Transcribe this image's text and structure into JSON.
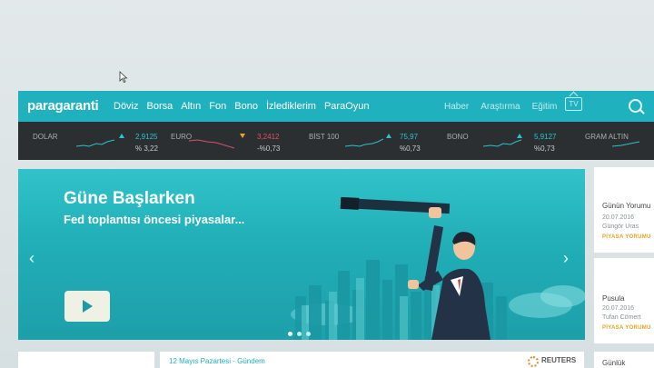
{
  "brand": {
    "logo": "paragaranti"
  },
  "nav": {
    "items": [
      "Döviz",
      "Borsa",
      "Altın",
      "Fon",
      "Bono",
      "İzlediklerim",
      "ParaOyun"
    ],
    "right_items": [
      "Haber",
      "Araştırma",
      "Eğitim"
    ],
    "tv_label": "TV"
  },
  "ticker": [
    {
      "name": "DOLAR",
      "value": "2,9125",
      "change": "% 3,22",
      "direction": "up"
    },
    {
      "name": "EURO",
      "value": "3,2412",
      "change": "-%0,73",
      "direction": "down"
    },
    {
      "name": "BİST 100",
      "value": "75,97",
      "change": "%0,73",
      "direction": "up"
    },
    {
      "name": "BONO",
      "value": "5,9127",
      "change": "%0,73",
      "direction": "up"
    },
    {
      "name": "GRAM ALTIN",
      "value": "",
      "change": "",
      "direction": ""
    }
  ],
  "hero": {
    "title": "Güne Başlarken",
    "subtitle": "Fed toplantısı öncesi piyasalar..."
  },
  "side_cards": [
    {
      "title": "Günün Yorumu",
      "date": "20.07.2016",
      "author": "Güngör Uras",
      "tag": "PİYASA YORUMU"
    },
    {
      "title": "Pusula",
      "date": "20.07.2016",
      "author": "Tufan Cömert",
      "tag": "PİYASA YORUMU"
    },
    {
      "title": "Günlük"
    }
  ],
  "bottom": {
    "news_title": "12 Mayıs Pazartesi - Gündem",
    "source": "REUTERS"
  },
  "colors": {
    "accent": "#1fb1bd",
    "ticker_bg": "#2b2f31",
    "up": "#29c4cf",
    "down": "#f0a030",
    "tag": "#e0a325"
  }
}
